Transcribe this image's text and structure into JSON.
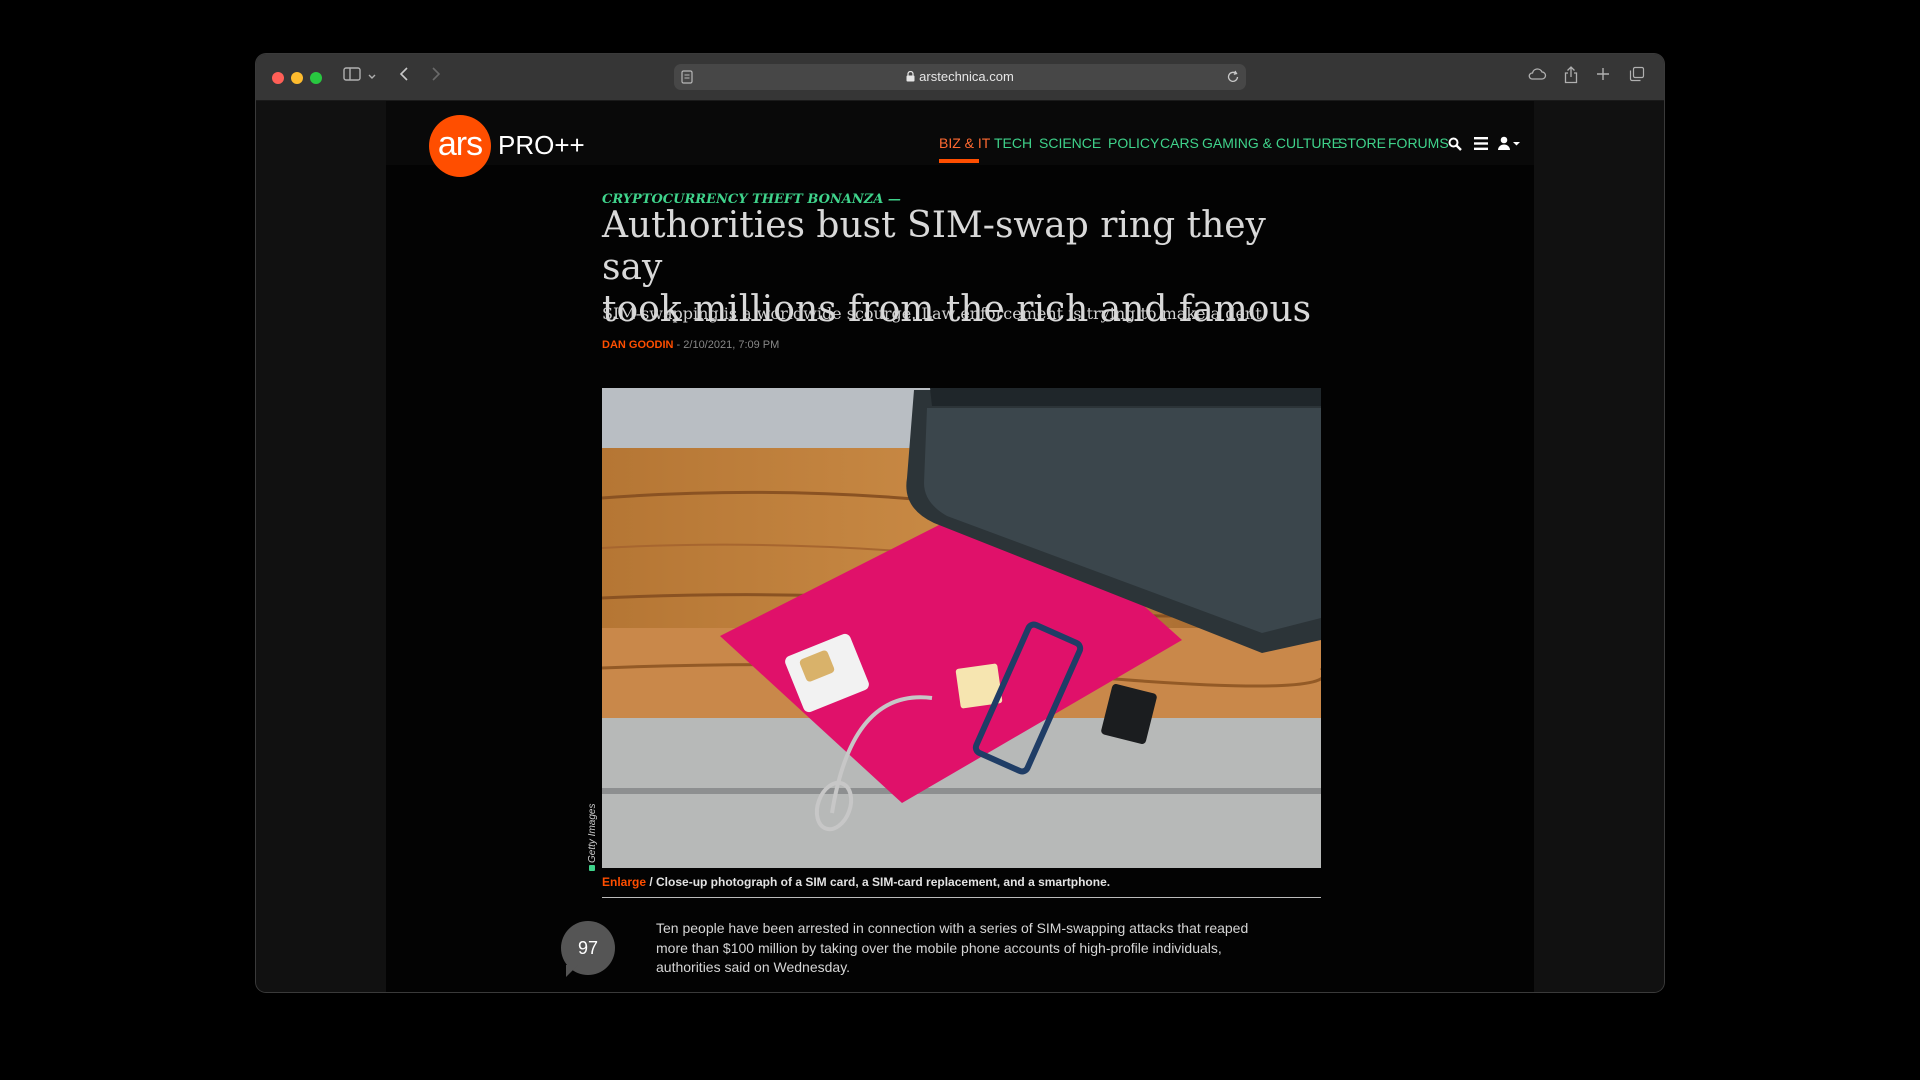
{
  "browser": {
    "url": "arstechnica.com",
    "traffic_lights": [
      "#ff5f57",
      "#febc2e",
      "#28c840"
    ]
  },
  "site": {
    "logo_text": "ars",
    "logo_suffix": "PRO++",
    "accent_color": "#ff4e00",
    "nav_color": "#3fd38b",
    "nav": [
      {
        "label": "BIZ & IT",
        "active": true
      },
      {
        "label": "TECH"
      },
      {
        "label": "SCIENCE"
      },
      {
        "label": "POLICY"
      },
      {
        "label": "CARS"
      },
      {
        "label": "GAMING & CULTURE"
      },
      {
        "label": "STORE"
      },
      {
        "label": "FORUMS"
      }
    ],
    "header_icons": [
      "search-icon",
      "menu-icon",
      "user-icon"
    ]
  },
  "article": {
    "kicker": "CRYPTOCURRENCY THEFT BONANZA —",
    "headline_line1": "Authorities bust SIM-swap ring they say",
    "headline_line2": "took millions from the rich and famous",
    "dek": "SIM-swapping is a worldwide scourge. Law enforcement is trying to make a dent.",
    "author": "DAN GOODIN",
    "date": " - 2/10/2021, 7:09 PM",
    "image_credit": "Getty Images",
    "caption_enlarge": "Enlarge",
    "caption_text": " / Close-up photograph of a SIM card, a SIM-card replacement, and a smartphone.",
    "comment_count": "97",
    "body_line1": "Ten people have been arrested in connection with a series of SIM-swapping attacks that reaped",
    "body_line2": "more than $100 million by taking over the mobile phone accounts of high-profile individuals,",
    "body_line3": "authorities said on Wednesday."
  }
}
